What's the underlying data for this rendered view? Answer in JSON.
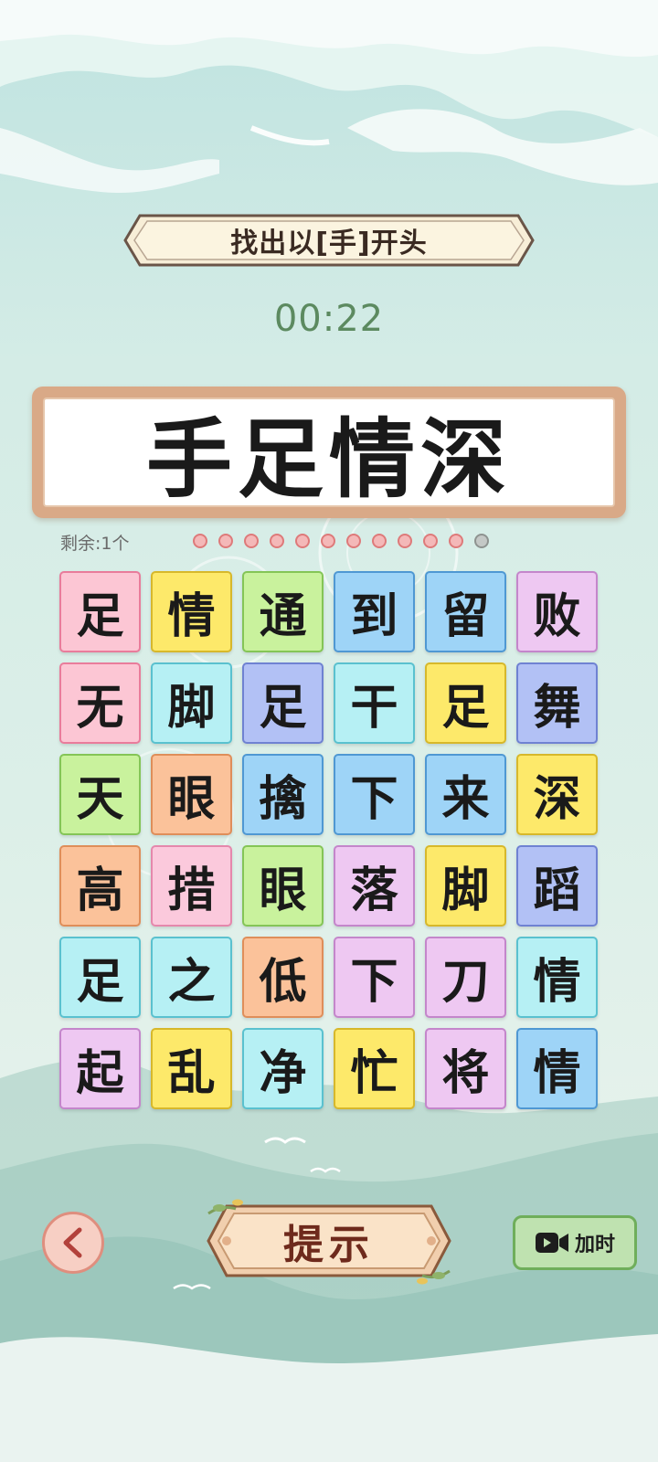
{
  "banner": {
    "title": "找出以[手]开头"
  },
  "timer": {
    "value": "00:22"
  },
  "answer": {
    "text": "手足情深"
  },
  "progress": {
    "remaining_label": "剩余:1个",
    "total_dots": 12,
    "filled_dots": 11
  },
  "grid": {
    "rows": [
      [
        {
          "ch": "足",
          "color": "pink"
        },
        {
          "ch": "情",
          "color": "yellow"
        },
        {
          "ch": "通",
          "color": "green"
        },
        {
          "ch": "到",
          "color": "blue"
        },
        {
          "ch": "留",
          "color": "blue"
        },
        {
          "ch": "败",
          "color": "lavender"
        }
      ],
      [
        {
          "ch": "无",
          "color": "pink"
        },
        {
          "ch": "脚",
          "color": "cyan"
        },
        {
          "ch": "足",
          "color": "periwinkle"
        },
        {
          "ch": "干",
          "color": "cyan"
        },
        {
          "ch": "足",
          "color": "yellow"
        },
        {
          "ch": "舞",
          "color": "periwinkle"
        }
      ],
      [
        {
          "ch": "天",
          "color": "green"
        },
        {
          "ch": "眼",
          "color": "peach"
        },
        {
          "ch": "擒",
          "color": "blue"
        },
        {
          "ch": "下",
          "color": "blue"
        },
        {
          "ch": "来",
          "color": "blue"
        },
        {
          "ch": "深",
          "color": "yellow"
        }
      ],
      [
        {
          "ch": "高",
          "color": "peach"
        },
        {
          "ch": "措",
          "color": "rose"
        },
        {
          "ch": "眼",
          "color": "green"
        },
        {
          "ch": "落",
          "color": "lavender"
        },
        {
          "ch": "脚",
          "color": "yellow"
        },
        {
          "ch": "蹈",
          "color": "periwinkle"
        }
      ],
      [
        {
          "ch": "足",
          "color": "cyan"
        },
        {
          "ch": "之",
          "color": "cyan"
        },
        {
          "ch": "低",
          "color": "peach"
        },
        {
          "ch": "下",
          "color": "lavender"
        },
        {
          "ch": "刀",
          "color": "lavender"
        },
        {
          "ch": "情",
          "color": "cyan"
        }
      ],
      [
        {
          "ch": "起",
          "color": "lavender"
        },
        {
          "ch": "乱",
          "color": "yellow"
        },
        {
          "ch": "净",
          "color": "cyan"
        },
        {
          "ch": "忙",
          "color": "yellow"
        },
        {
          "ch": "将",
          "color": "lavender"
        },
        {
          "ch": "情",
          "color": "blue"
        }
      ]
    ]
  },
  "controls": {
    "back_icon": "chevron-left-icon",
    "hint_label": "提示",
    "addtime_icon": "video-camera-icon",
    "addtime_label": "加时"
  },
  "colors": {
    "pink": "#fcc6d4",
    "yellow": "#fde96a",
    "green": "#c9f29d",
    "blue": "#9ed4f7",
    "lavender": "#eec8f2",
    "cyan": "#b6f0f4",
    "periwinkle": "#b2c1f5",
    "peach": "#fbc29a",
    "rose": "#fbc9dc",
    "timer": "#5c8a60",
    "answer_frame": "#d9a987"
  }
}
